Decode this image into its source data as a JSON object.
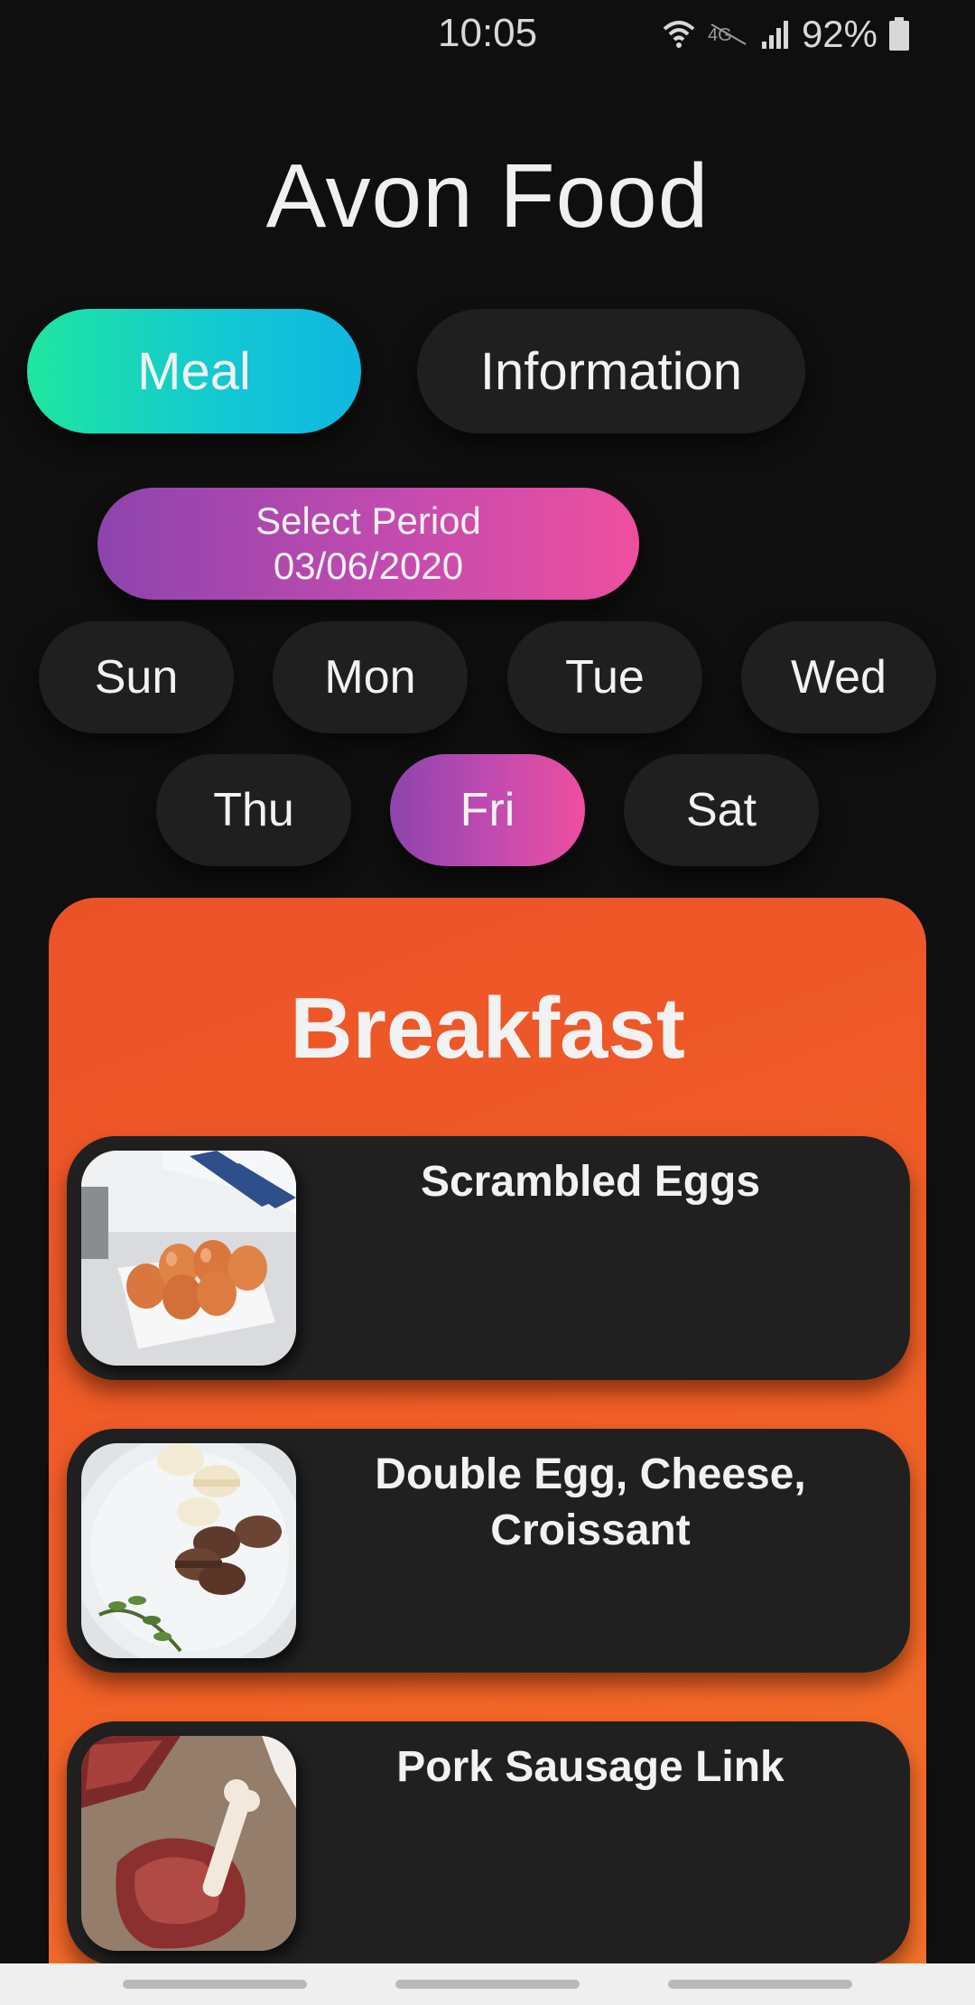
{
  "status_bar": {
    "time": "10:05",
    "battery": "92%",
    "icons": [
      "wifi-icon",
      "4g-icon",
      "signal-icon",
      "battery-icon"
    ]
  },
  "app": {
    "title": "Avon Food"
  },
  "tabs": [
    {
      "label": "Meal",
      "active": true
    },
    {
      "label": "Information",
      "active": false
    }
  ],
  "period": {
    "label": "Select Period",
    "date": "03/06/2020"
  },
  "days": [
    {
      "label": "Sun",
      "active": false
    },
    {
      "label": "Mon",
      "active": false
    },
    {
      "label": "Tue",
      "active": false
    },
    {
      "label": "Wed",
      "active": false
    },
    {
      "label": "Thu",
      "active": false
    },
    {
      "label": "Fri",
      "active": true
    },
    {
      "label": "Sat",
      "active": false
    }
  ],
  "meal": {
    "title": "Breakfast",
    "items": [
      {
        "name": "Scrambled Eggs",
        "image": "eggs-image"
      },
      {
        "name": "Double Egg, Cheese, Croissant",
        "image": "macarons-image"
      },
      {
        "name": "Pork Sausage Link",
        "image": "meat-image"
      }
    ]
  },
  "colors": {
    "background": "#0f0f0f",
    "tab_active_start": "#1fe6a0",
    "tab_active_end": "#0eb7e0",
    "accent_purple": "#8d44ad",
    "accent_pink": "#ee4f9e",
    "card_orange": "#f15f27",
    "pill_dark": "#1f1f1f"
  }
}
